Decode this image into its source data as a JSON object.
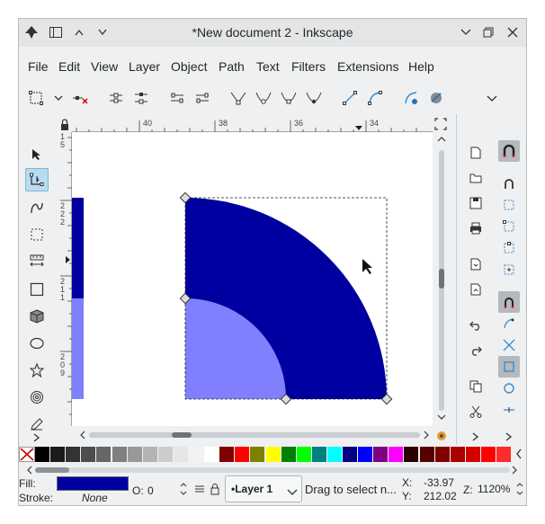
{
  "window": {
    "title": "*New document 2 - Inkscape"
  },
  "menu": [
    "File",
    "Edit",
    "View",
    "Layer",
    "Object",
    "Path",
    "Text",
    "Filters",
    "Extensions",
    "Help"
  ],
  "ruler": {
    "h_ticks": [
      "40",
      "38",
      "36",
      "34"
    ],
    "v_ticks": [
      "1",
      "5",
      "2",
      "2",
      "2",
      "2",
      "1",
      "1",
      "2",
      "0",
      "9"
    ]
  },
  "palette": {
    "colors": [
      "#000000",
      "#1a1a1a",
      "#333333",
      "#4d4d4d",
      "#666666",
      "#808080",
      "#999999",
      "#b3b3b3",
      "#cccccc",
      "#e6e6e6",
      "#f2f2f2",
      "#ffffff",
      "#800000",
      "#ff0000",
      "#808000",
      "#ffff00",
      "#008000",
      "#00ff00",
      "#008080",
      "#00ffff",
      "#000080",
      "#0000ff",
      "#800080",
      "#ff00ff",
      "#2b0000",
      "#550000",
      "#800000",
      "#aa0000",
      "#d40000",
      "#ff0000",
      "#ff2a2a"
    ]
  },
  "canvas": {
    "colors": {
      "dark_fill": "#0000a0",
      "light_fill": "#8080ff"
    }
  },
  "status": {
    "fill_label": "Fill:",
    "fill_color": "#0000a0",
    "stroke_label": "Stroke:",
    "stroke_value": "None",
    "opacity_label": "O:",
    "opacity_value": "0",
    "layer": "•Layer 1",
    "message": "Drag to select n...",
    "x_label": "X:",
    "x_value": "-33.97",
    "y_label": "Y:",
    "y_value": "212.02",
    "zoom_label": "Z:",
    "zoom_value": "1120%"
  }
}
